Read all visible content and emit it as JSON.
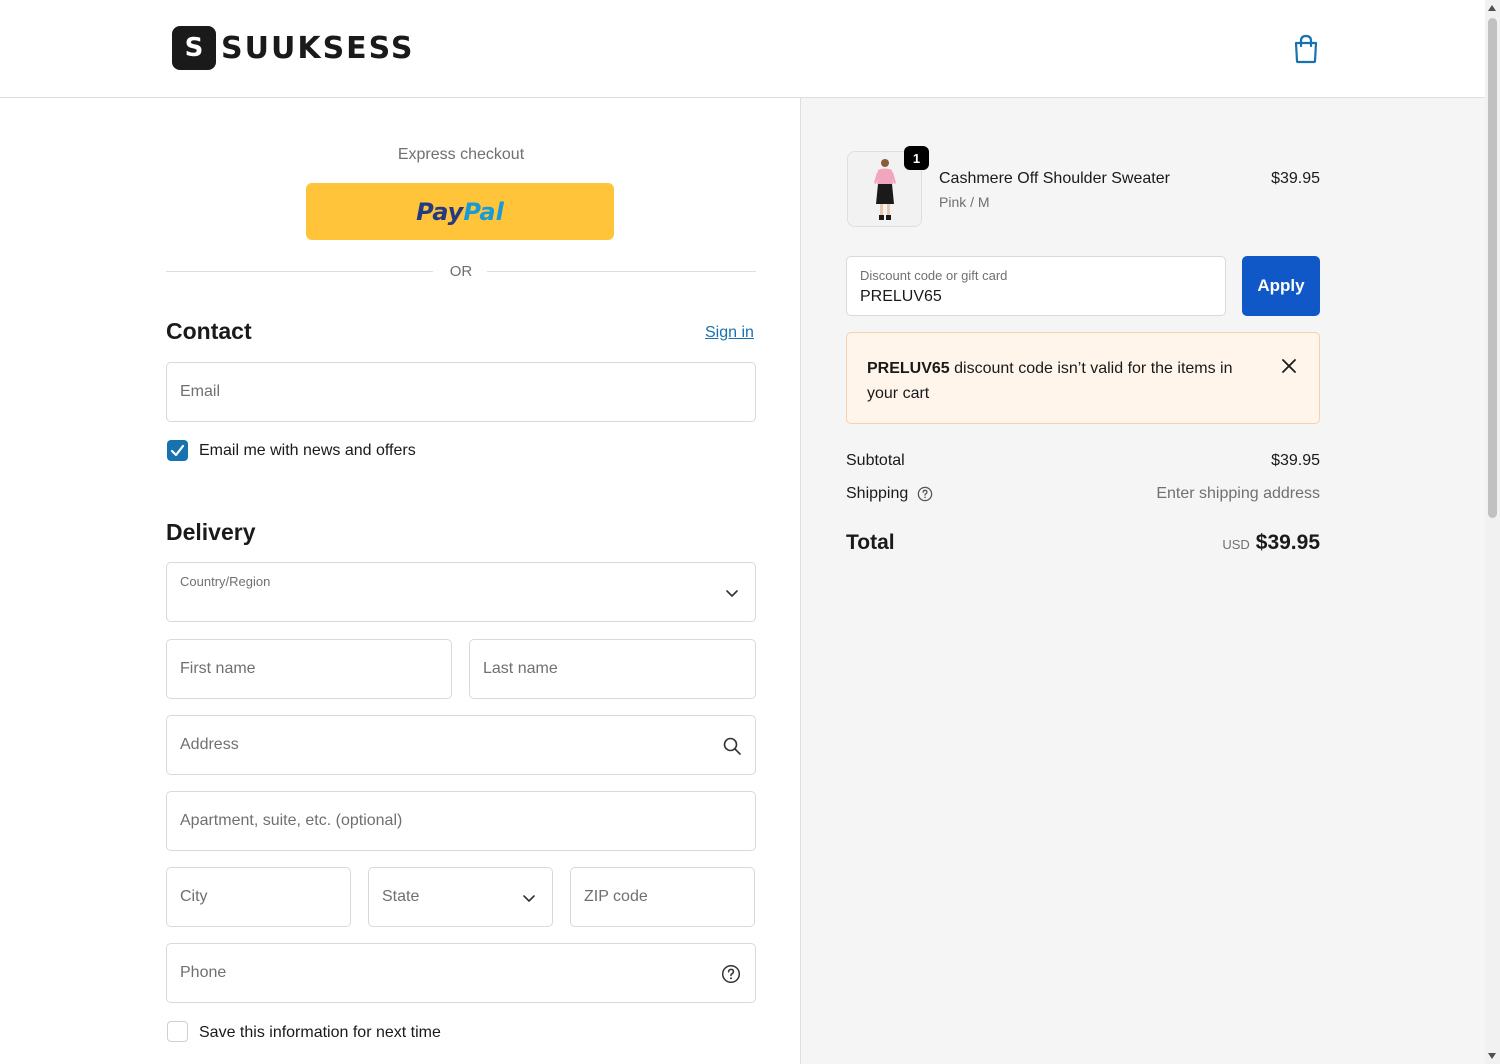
{
  "brand": {
    "name": "SUUKSESS",
    "mark": "S"
  },
  "express": {
    "label": "Express checkout",
    "paypal_part1": "Pay",
    "paypal_part2": "Pal",
    "or_label": "OR"
  },
  "contact": {
    "title": "Contact",
    "sign_in": "Sign in",
    "email_placeholder": "Email",
    "newsletter_label": "Email me with news and offers",
    "newsletter_checked": true
  },
  "delivery": {
    "title": "Delivery",
    "country_label": "Country/Region",
    "first_name": "First name",
    "last_name": "Last name",
    "address": "Address",
    "apartment": "Apartment, suite, etc. (optional)",
    "city": "City",
    "state": "State",
    "zip": "ZIP code",
    "phone": "Phone",
    "save_info_label": "Save this information for next time",
    "save_info_checked": false
  },
  "order": {
    "quantity": "1",
    "product_name": "Cashmere Off Shoulder Sweater",
    "product_variant": "Pink / M",
    "product_price": "$39.95",
    "discount_label": "Discount code or gift card",
    "discount_value": "PRELUV65",
    "apply_label": "Apply",
    "alert_code": "PRELUV65",
    "alert_message": " discount code isn’t valid for the items in your cart",
    "subtotal_label": "Subtotal",
    "subtotal_value": "$39.95",
    "shipping_label": "Shipping",
    "shipping_value": "Enter shipping address",
    "total_label": "Total",
    "total_currency": "USD",
    "total_value": "$39.95"
  },
  "colors": {
    "primary_button": "#1058c7",
    "link": "#1773b0",
    "paypal": "#ffc439",
    "alert_bg": "#fff5ea"
  }
}
